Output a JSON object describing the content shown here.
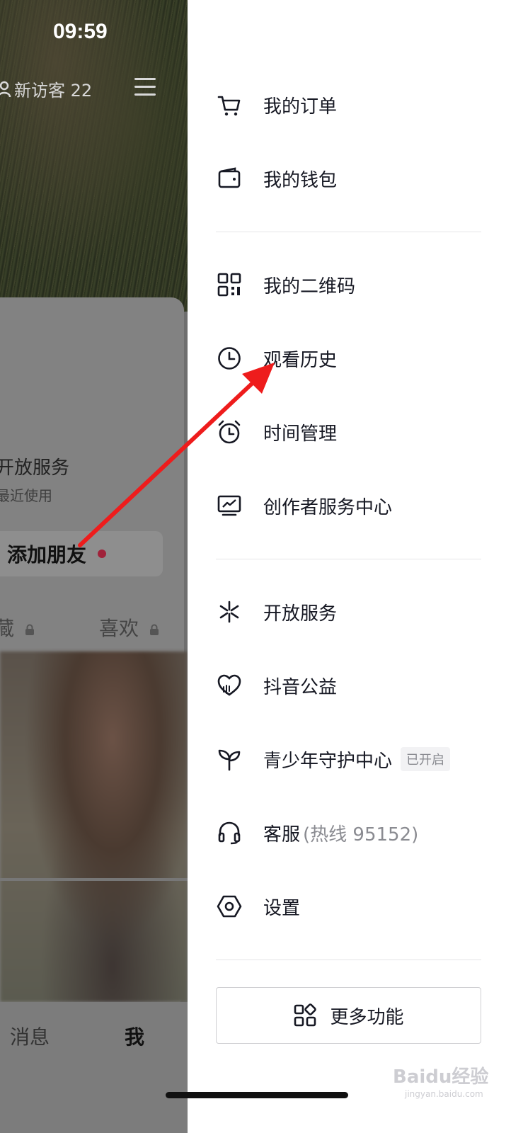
{
  "status_bar": {
    "time": "09:59"
  },
  "profile_page": {
    "visitor_text": "新访客 22",
    "open_service_title": "开放服务",
    "recent_use": "最近使用",
    "add_friend": "添加朋友",
    "tabs": {
      "collect": "藏",
      "like": "喜欢"
    },
    "bottom_nav": {
      "messages": "消息",
      "me": "我"
    }
  },
  "drawer": {
    "group1": [
      {
        "label": "我的订单",
        "icon": "cart-icon"
      },
      {
        "label": "我的钱包",
        "icon": "wallet-icon"
      }
    ],
    "group2": [
      {
        "label": "我的二维码",
        "icon": "qrcode-icon"
      },
      {
        "label": "观看历史",
        "icon": "clock-icon"
      },
      {
        "label": "时间管理",
        "icon": "alarm-icon"
      },
      {
        "label": "创作者服务中心",
        "icon": "creator-chart-icon"
      }
    ],
    "group3": [
      {
        "label": "开放服务",
        "icon": "asterisk-icon"
      },
      {
        "label": "抖音公益",
        "icon": "charity-heart-icon"
      },
      {
        "label": "青少年守护中心",
        "icon": "sprout-icon",
        "badge": "已开启"
      },
      {
        "label": "客服",
        "extra": "(热线 95152)",
        "icon": "headset-icon"
      },
      {
        "label": "设置",
        "icon": "hex-gear-icon"
      }
    ],
    "more_button": "更多功能"
  },
  "watermark": {
    "main": "Baidu经验",
    "sub": "jingyan.baidu.com"
  },
  "colors": {
    "annotation_arrow": "#ee1c1c",
    "badge_bg": "#f2f2f4",
    "text": "#161823"
  }
}
